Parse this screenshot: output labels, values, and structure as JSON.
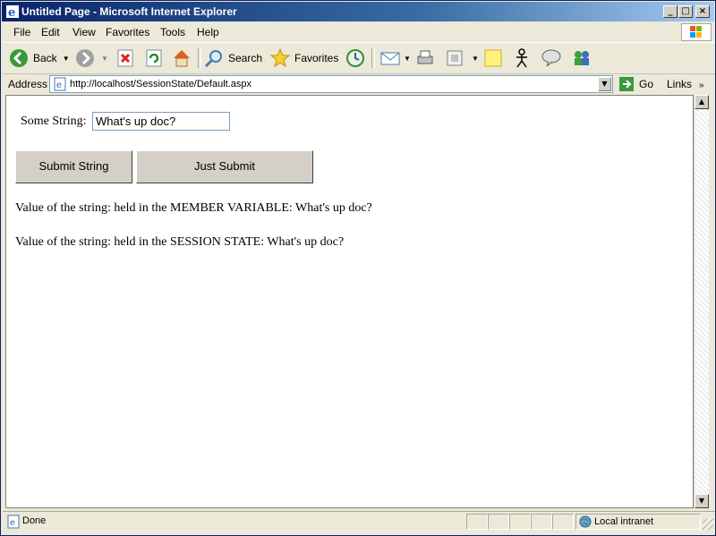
{
  "window": {
    "title": "Untitled Page - Microsoft Internet Explorer"
  },
  "menu": [
    "File",
    "Edit",
    "View",
    "Favorites",
    "Tools",
    "Help"
  ],
  "toolbar": {
    "back": "Back",
    "search": "Search",
    "favorites": "Favorites"
  },
  "address": {
    "label": "Address",
    "url": "http://localhost/SessionState/Default.aspx",
    "go": "Go",
    "links": "Links"
  },
  "page": {
    "field_label": "Some String:",
    "field_value": "What's up doc?",
    "submit_string": "Submit String",
    "just_submit": "Just Submit",
    "member_line": "Value of the string: held in the MEMBER VARIABLE:  What's up doc?",
    "session_line": "Value of the string: held in the SESSION STATE: What's up doc?"
  },
  "status": {
    "text": "Done",
    "zone": "Local intranet"
  },
  "colors": {
    "title_start": "#0a246a",
    "title_end": "#a6caf0",
    "chrome": "#ece9d8"
  }
}
